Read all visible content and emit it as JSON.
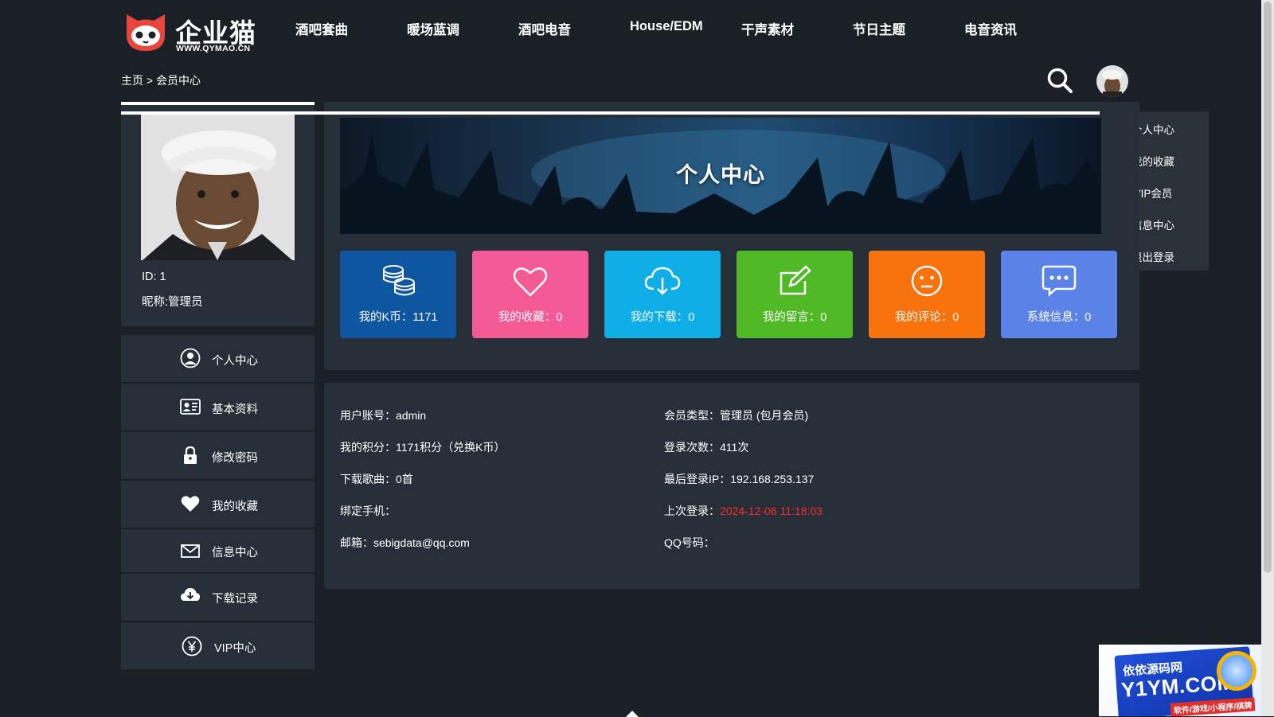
{
  "brand": {
    "name": "企业猫",
    "site": "WWW.QYMAO.CN",
    "accent": "#e8453c"
  },
  "nav": [
    {
      "label": "酒吧套曲"
    },
    {
      "label": "暖场蓝调"
    },
    {
      "label": "酒吧电音"
    },
    {
      "label": "House/EDM"
    },
    {
      "label": "干声素材"
    },
    {
      "label": "节日主题"
    },
    {
      "label": "电音资讯"
    }
  ],
  "breadcrumb": "主页 > 会员中心",
  "dropdown": [
    {
      "label": "个人中心"
    },
    {
      "label": "我的收藏"
    },
    {
      "label": "VIP会员"
    },
    {
      "label": "信息中心"
    },
    {
      "label": "退出登录"
    }
  ],
  "profile": {
    "id": "ID: 1",
    "nickname": "昵称:管理员"
  },
  "sidebar": [
    {
      "label": "个人中心",
      "icon": "user-circle-icon"
    },
    {
      "label": "基本资料",
      "icon": "id-card-icon"
    },
    {
      "label": "修改密码",
      "icon": "lock-icon"
    },
    {
      "label": "我的收藏",
      "icon": "heart-icon"
    },
    {
      "label": "信息中心",
      "icon": "envelope-icon"
    },
    {
      "label": "下载记录",
      "icon": "cloud-download-icon"
    },
    {
      "label": "VIP中心",
      "icon": "yen-circle-icon"
    }
  ],
  "banner": {
    "title": "个人中心"
  },
  "tiles": [
    {
      "label": "我的K币：1171",
      "icon": "coins-icon",
      "color": "#0e57a0"
    },
    {
      "label": "我的收藏：0",
      "icon": "heart-icon",
      "color": "#f35a96"
    },
    {
      "label": "我的下载：0",
      "icon": "cloud-download-icon",
      "color": "#10aee7"
    },
    {
      "label": "我的留言：0",
      "icon": "edit-icon",
      "color": "#50b926"
    },
    {
      "label": "我的评论：0",
      "icon": "smile-icon",
      "color": "#f8720e"
    },
    {
      "label": "系统信息：0",
      "icon": "chat-icon",
      "color": "#5b82e6"
    }
  ],
  "info_left": [
    {
      "label": "用户账号：",
      "value": "admin"
    },
    {
      "label": "我的积分：",
      "value": "1171积分（兑换K币）"
    },
    {
      "label": "下载歌曲：",
      "value": "0首"
    },
    {
      "label": "绑定手机：",
      "value": ""
    },
    {
      "label": "邮箱：",
      "value": "sebigdata@qq.com"
    }
  ],
  "info_right": [
    {
      "label": "会员类型：",
      "value": "管理员 (包月会员)"
    },
    {
      "label": "登录次数：",
      "value": "411次"
    },
    {
      "label": "最后登录IP：",
      "value": "192.168.253.137"
    },
    {
      "label": "上次登录：",
      "value": "2024-12-06 11:18:03",
      "highlight": "#ff2a2a"
    },
    {
      "label": "QQ号码：",
      "value": ""
    }
  ],
  "ad": {
    "line1": "依依源码网",
    "line2": "Y1YM.COM",
    "line3": "软件/游戏/小程序/棋牌"
  }
}
